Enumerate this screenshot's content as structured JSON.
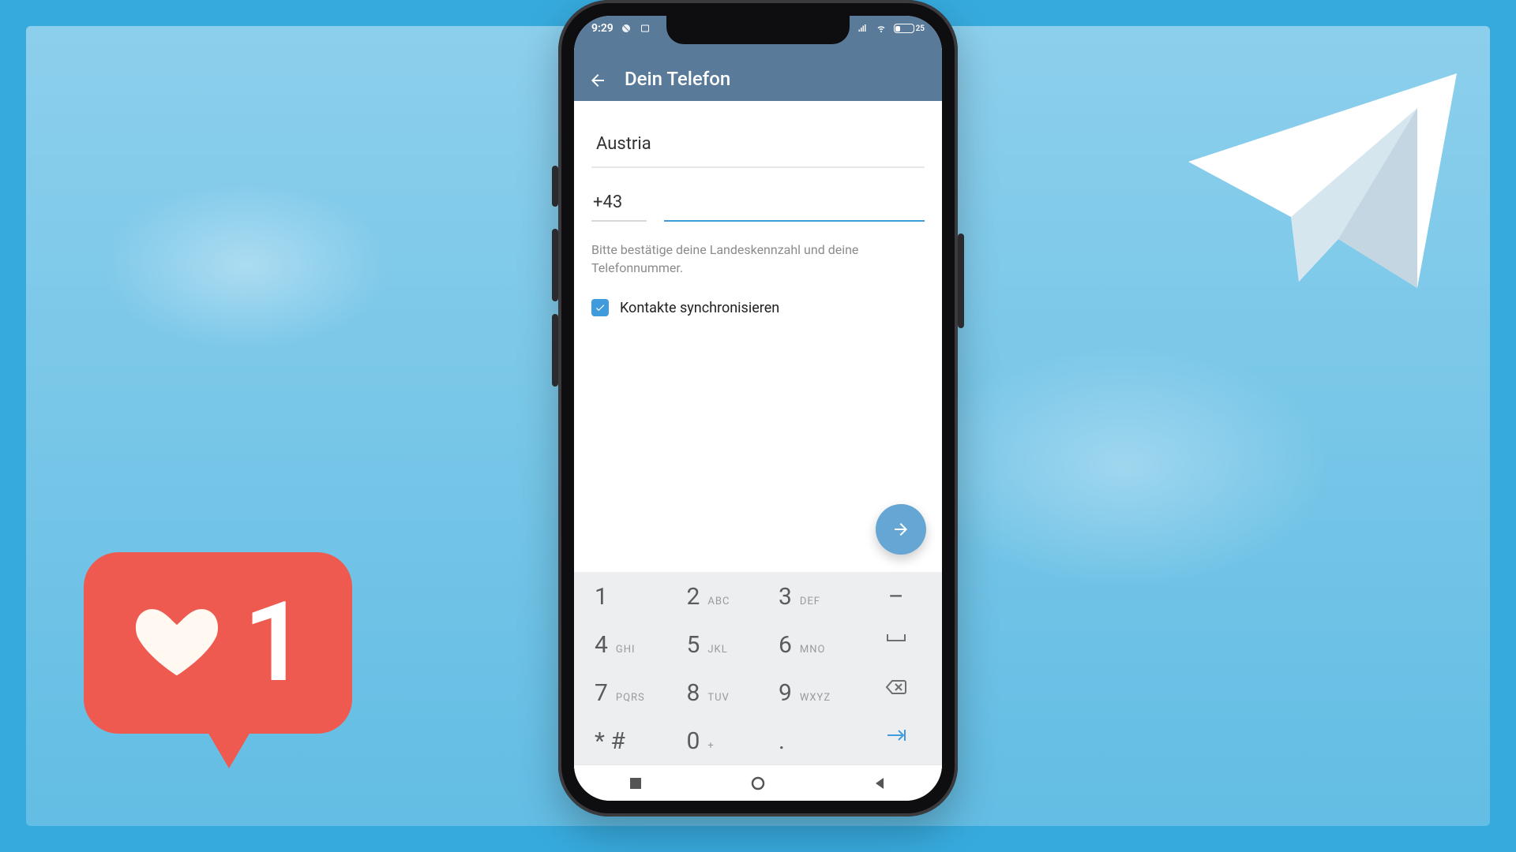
{
  "status_bar": {
    "time": "9:29",
    "battery_pct": "25"
  },
  "header": {
    "title": "Dein Telefon"
  },
  "form": {
    "country": "Austria",
    "dial_code": "+43",
    "phone_value": "",
    "helper_text": "Bitte bestätige deine Landeskennzahl und deine Telefonnummer.",
    "sync_label": "Kontakte synchronisieren",
    "sync_checked": true
  },
  "keypad": {
    "rows": [
      [
        {
          "d": "1",
          "s": ""
        },
        {
          "d": "2",
          "s": "ABC"
        },
        {
          "d": "3",
          "s": "DEF"
        },
        {
          "d": "–",
          "s": "",
          "icon": "dash"
        }
      ],
      [
        {
          "d": "4",
          "s": "GHI"
        },
        {
          "d": "5",
          "s": "JKL"
        },
        {
          "d": "6",
          "s": "MNO"
        },
        {
          "d": "",
          "s": "",
          "icon": "space"
        }
      ],
      [
        {
          "d": "7",
          "s": "PQRS"
        },
        {
          "d": "8",
          "s": "TUV"
        },
        {
          "d": "9",
          "s": "WXYZ"
        },
        {
          "d": "",
          "s": "",
          "icon": "backspace"
        }
      ],
      [
        {
          "d": "* #",
          "s": ""
        },
        {
          "d": "0",
          "s": "+"
        },
        {
          "d": ".",
          "s": ""
        },
        {
          "d": "",
          "s": "",
          "icon": "next"
        }
      ]
    ]
  },
  "like": {
    "count": "1"
  }
}
